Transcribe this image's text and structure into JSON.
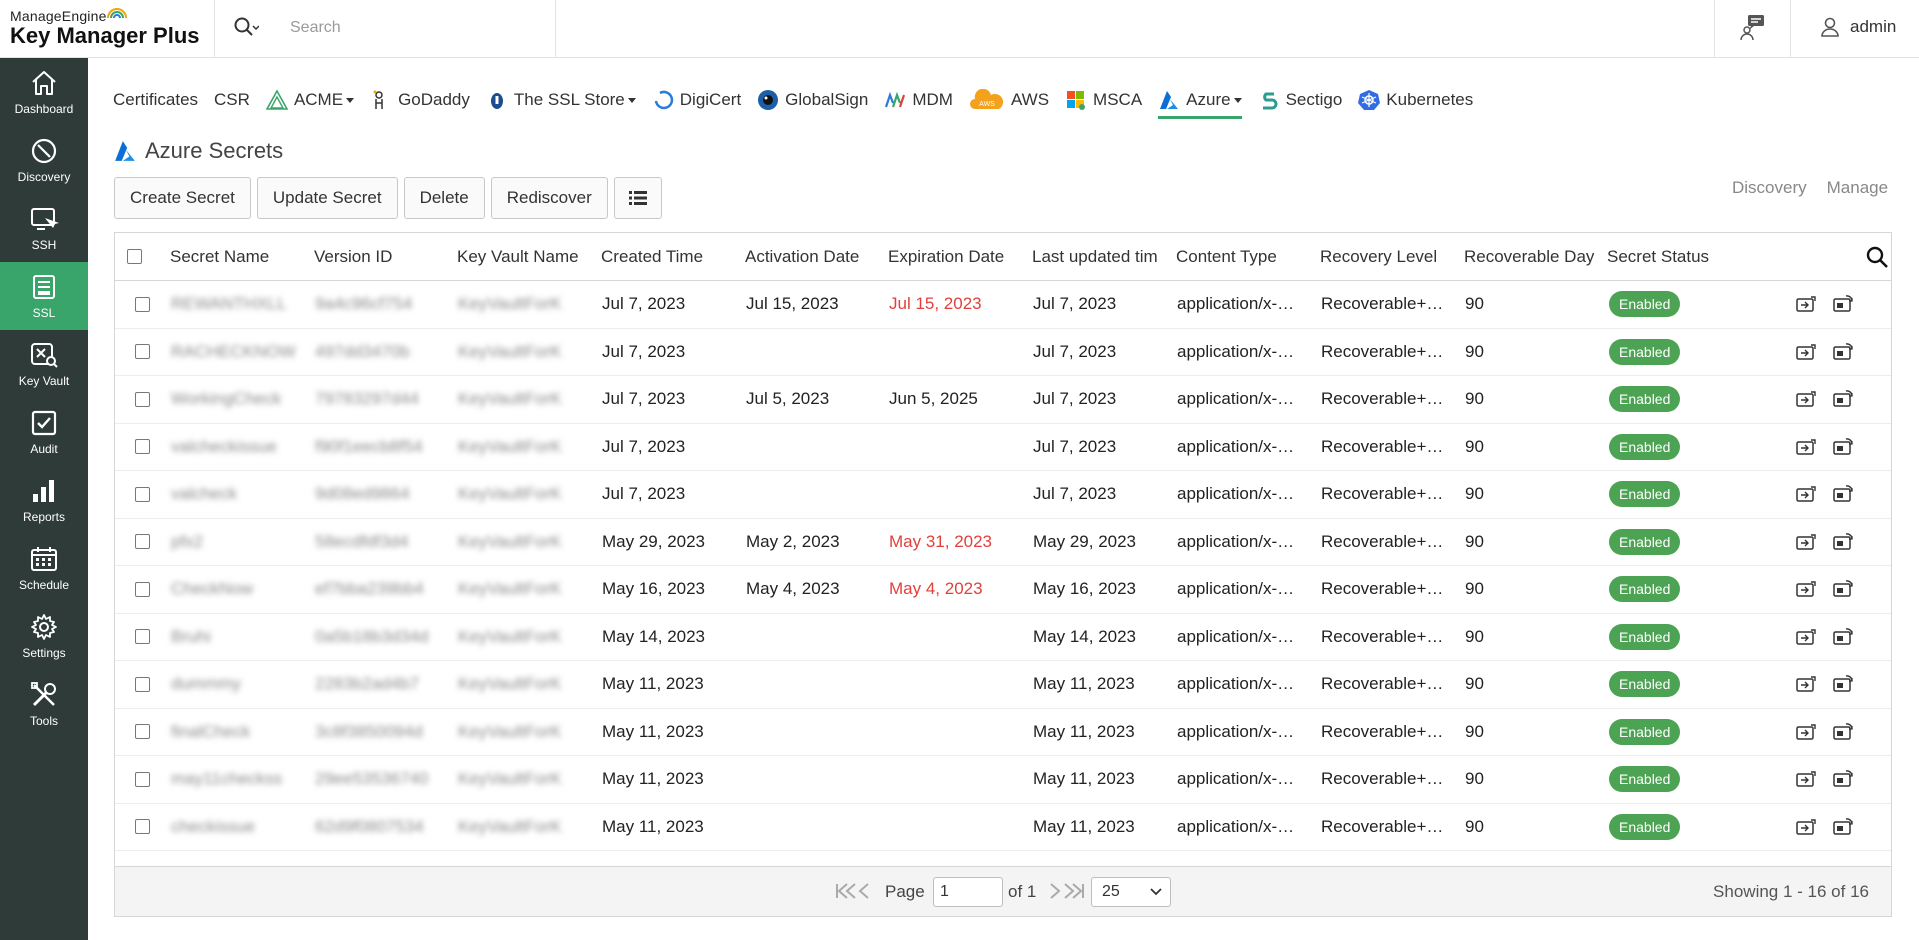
{
  "header": {
    "brand_small": "ManageEngine",
    "brand_big": "Key Manager Plus",
    "search_placeholder": "Search",
    "user": "admin"
  },
  "sidebar": {
    "items": [
      {
        "label": "Dashboard",
        "icon": "home-icon"
      },
      {
        "label": "Discovery",
        "icon": "discovery-icon"
      },
      {
        "label": "SSH",
        "icon": "ssh-icon"
      },
      {
        "label": "SSL",
        "icon": "ssl-icon",
        "active": true
      },
      {
        "label": "Key Vault",
        "icon": "key-vault-icon"
      },
      {
        "label": "Audit",
        "icon": "audit-icon"
      },
      {
        "label": "Reports",
        "icon": "reports-icon"
      },
      {
        "label": "Schedule",
        "icon": "calendar-icon"
      },
      {
        "label": "Settings",
        "icon": "gear-icon"
      },
      {
        "label": "Tools",
        "icon": "tools-icon"
      }
    ]
  },
  "tabs": [
    {
      "label": "Certificates"
    },
    {
      "label": "CSR"
    },
    {
      "label": "ACME",
      "icon": "acme-icon",
      "dropdown": true
    },
    {
      "label": "GoDaddy",
      "icon": "godaddy-icon"
    },
    {
      "label": "The SSL Store",
      "icon": "ssl-store-icon",
      "dropdown": true
    },
    {
      "label": "DigiCert",
      "icon": "digicert-icon"
    },
    {
      "label": "GlobalSign",
      "icon": "globalsign-icon"
    },
    {
      "label": "MDM",
      "icon": "mdm-icon"
    },
    {
      "label": "AWS",
      "icon": "aws-icon"
    },
    {
      "label": "MSCA",
      "icon": "msca-icon"
    },
    {
      "label": "Azure",
      "icon": "azure-icon",
      "dropdown": true,
      "active": true
    },
    {
      "label": "Sectigo",
      "icon": "sectigo-icon"
    },
    {
      "label": "Kubernetes",
      "icon": "kubernetes-icon"
    }
  ],
  "page": {
    "title": "Azure Secrets",
    "buttons": {
      "create": "Create Secret",
      "update": "Update Secret",
      "delete": "Delete",
      "rediscover": "Rediscover"
    },
    "view_links": {
      "discovery": "Discovery",
      "manage": "Manage"
    }
  },
  "table": {
    "columns": [
      "Secret Name",
      "Version ID",
      "Key Vault Name",
      "Created Time",
      "Activation Date",
      "Expiration Date",
      "Last updated tim",
      "Content Type",
      "Recovery Level",
      "Recoverable Day",
      "Secret Status"
    ],
    "rows": [
      {
        "name": "REWANTHXLL",
        "version": "9a4c96cf754",
        "vault": "KeyVaultForK",
        "created": "Jul 7, 2023",
        "activation": "Jul 15, 2023",
        "expiration": "Jul 15, 2023",
        "exp_red": true,
        "updated": "Jul 7, 2023",
        "content": "application/x-…",
        "recovery": "Recoverable+…",
        "days": "90",
        "status": "Enabled"
      },
      {
        "name": "RACHECKNOW",
        "version": "497dd3470b",
        "vault": "KeyVaultForK",
        "created": "Jul 7, 2023",
        "activation": "",
        "expiration": "",
        "exp_red": false,
        "updated": "Jul 7, 2023",
        "content": "application/x-…",
        "recovery": "Recoverable+…",
        "days": "90",
        "status": "Enabled"
      },
      {
        "name": "WorkingCheck",
        "version": "79783297d44",
        "vault": "KeyVaultForK",
        "created": "Jul 7, 2023",
        "activation": "Jul 5, 2023",
        "expiration": "Jun 5, 2025",
        "exp_red": false,
        "updated": "Jul 7, 2023",
        "content": "application/x-…",
        "recovery": "Recoverable+…",
        "days": "90",
        "status": "Enabled"
      },
      {
        "name": "valcheckissue",
        "version": "f90f1eecb8f54",
        "vault": "KeyVaultForK",
        "created": "Jul 7, 2023",
        "activation": "",
        "expiration": "",
        "exp_red": false,
        "updated": "Jul 7, 2023",
        "content": "application/x-…",
        "recovery": "Recoverable+…",
        "days": "90",
        "status": "Enabled"
      },
      {
        "name": "valcheck",
        "version": "9d08ed9864",
        "vault": "KeyVaultForK",
        "created": "Jul 7, 2023",
        "activation": "",
        "expiration": "",
        "exp_red": false,
        "updated": "Jul 7, 2023",
        "content": "application/x-…",
        "recovery": "Recoverable+…",
        "days": "90",
        "status": "Enabled"
      },
      {
        "name": "pfx2",
        "version": "58ecdfdf3d4",
        "vault": "KeyVaultForK",
        "created": "May 29, 2023",
        "activation": "May 2, 2023",
        "expiration": "May 31, 2023",
        "exp_red": true,
        "updated": "May 29, 2023",
        "content": "application/x-…",
        "recovery": "Recoverable+…",
        "days": "90",
        "status": "Enabled"
      },
      {
        "name": "CheckNow",
        "version": "ef7bba239bb4",
        "vault": "KeyVaultForK",
        "created": "May 16, 2023",
        "activation": "May 4, 2023",
        "expiration": "May 4, 2023",
        "exp_red": true,
        "updated": "May 16, 2023",
        "content": "application/x-…",
        "recovery": "Recoverable+…",
        "days": "90",
        "status": "Enabled"
      },
      {
        "name": "Bruhi",
        "version": "0a5b18b3d34d",
        "vault": "KeyVaultForK",
        "created": "May 14, 2023",
        "activation": "",
        "expiration": "",
        "exp_red": false,
        "updated": "May 14, 2023",
        "content": "application/x-…",
        "recovery": "Recoverable+…",
        "days": "90",
        "status": "Enabled"
      },
      {
        "name": "dummmy",
        "version": "2283b2ad4b7",
        "vault": "KeyVaultForK",
        "created": "May 11, 2023",
        "activation": "",
        "expiration": "",
        "exp_red": false,
        "updated": "May 11, 2023",
        "content": "application/x-…",
        "recovery": "Recoverable+…",
        "days": "90",
        "status": "Enabled"
      },
      {
        "name": "finalCheck",
        "version": "3c8f3850094d",
        "vault": "KeyVaultForK",
        "created": "May 11, 2023",
        "activation": "",
        "expiration": "",
        "exp_red": false,
        "updated": "May 11, 2023",
        "content": "application/x-…",
        "recovery": "Recoverable+…",
        "days": "90",
        "status": "Enabled"
      },
      {
        "name": "may11checkss",
        "version": "29ee53536740",
        "vault": "KeyVaultForK",
        "created": "May 11, 2023",
        "activation": "",
        "expiration": "",
        "exp_red": false,
        "updated": "May 11, 2023",
        "content": "application/x-…",
        "recovery": "Recoverable+…",
        "days": "90",
        "status": "Enabled"
      },
      {
        "name": "checkissue",
        "version": "62d9f0807534",
        "vault": "KeyVaultForK",
        "created": "May 11, 2023",
        "activation": "",
        "expiration": "",
        "exp_red": false,
        "updated": "May 11, 2023",
        "content": "application/x-…",
        "recovery": "Recoverable+…",
        "days": "90",
        "status": "Enabled"
      }
    ]
  },
  "pager": {
    "page_label": "Page",
    "page_value": "1",
    "of_label": "of 1",
    "per_page": "25",
    "showing": "Showing 1 - 16 of 16"
  },
  "colors": {
    "sidebar": "#2e3b39",
    "accent": "#3aa56a",
    "badge": "#4ca353",
    "danger": "#e0413a"
  }
}
